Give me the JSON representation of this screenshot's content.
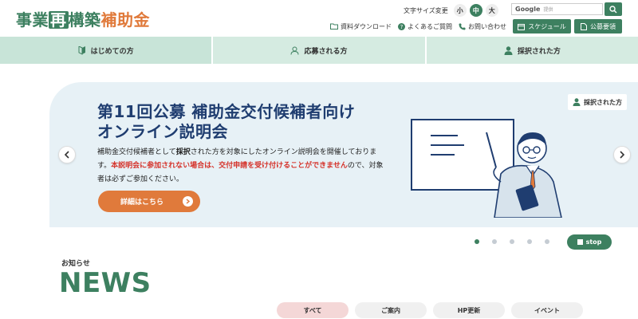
{
  "header": {
    "logo": {
      "part1": "事業",
      "box": "再",
      "part2": "構築",
      "part3": "補助金"
    },
    "font_size": {
      "label": "文字サイズ変更",
      "small": "小",
      "medium": "中",
      "large": "大",
      "selected": "中"
    },
    "search": {
      "brand": "Google",
      "placeholder": "提供"
    },
    "utility_links": {
      "download": "資料ダウンロード",
      "faq": "よくあるご質問",
      "contact": "お問い合わせ"
    },
    "buttons": {
      "schedule": "スケジュール",
      "guidelines": "公募要領"
    }
  },
  "nav": {
    "items": [
      "はじめての方",
      "応募される方",
      "採択された方"
    ]
  },
  "hero": {
    "tag": "採択された方",
    "title_line1": "第11回公募 補助金交付候補者向け",
    "title_line2": "オンライン説明会",
    "body_part1": "補助金交付候補者として",
    "body_bold": "採択",
    "body_part2": "された方を対象にしたオンライン説明会を開催しております。",
    "body_red": "本説明会に参加されない場合は、交付申請を受け付けることができません",
    "body_part3": "ので、対象者は必ずご参加ください。",
    "detail_button": "詳細はこちら"
  },
  "carousel": {
    "dot_count": 5,
    "active_index": 0,
    "stop_label": "stop"
  },
  "news": {
    "subtitle": "お知らせ",
    "title": "NEWS",
    "filters": [
      "すべて",
      "ご案内",
      "HP更新",
      "イベント"
    ],
    "active_filter": "すべて"
  },
  "colors": {
    "brand_green": "#3d8060",
    "accent_orange": "#e07a3b",
    "navy": "#1f3d70",
    "alert_red": "#d5332b"
  }
}
